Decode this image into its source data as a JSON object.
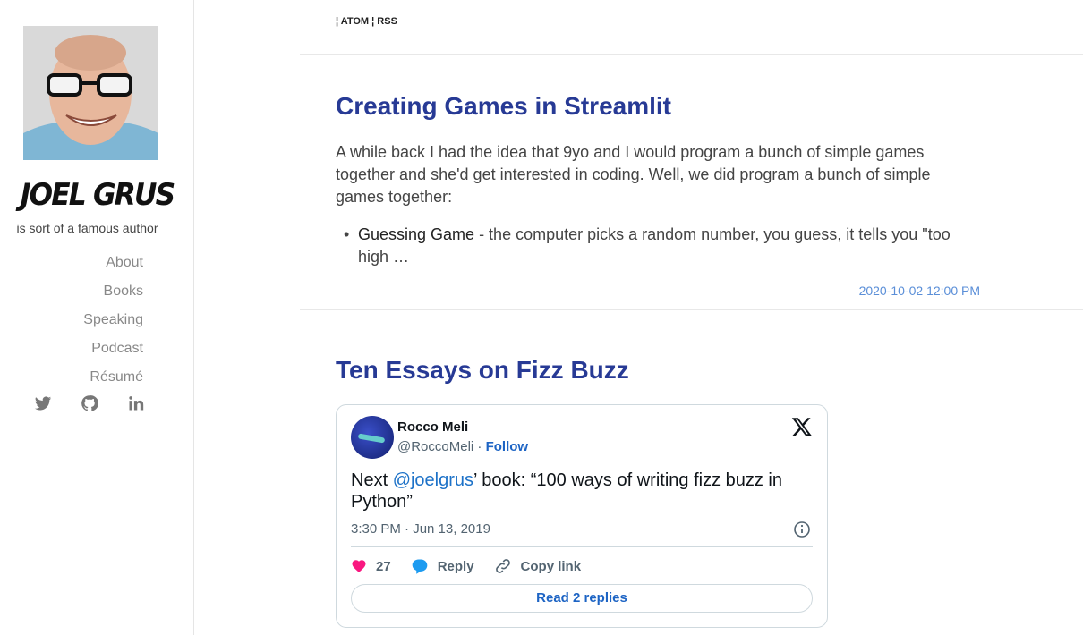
{
  "sidebar": {
    "title": "JOEL GRUS",
    "tagline": "is sort of a famous author",
    "nav": [
      "About",
      "Books",
      "Speaking",
      "Podcast",
      "Résumé"
    ],
    "social_icons": [
      "twitter-icon",
      "github-icon",
      "linkedin-icon"
    ]
  },
  "header": {
    "feeds": "¦ ATOM ¦ RSS"
  },
  "posts": [
    {
      "title": "Creating Games in Streamlit",
      "body": "A while back I had the idea that 9yo and I would program a bunch of simple games together and she'd get interested in coding. Well, we did program a bunch of simple games together:",
      "bullet_link": "Guessing Game",
      "bullet_text": " - the computer picks a random number, you guess, it tells you \"too high …",
      "date": "2020-10-02 12:00 PM"
    },
    {
      "title": "Ten Essays on Fizz Buzz"
    }
  ],
  "tweet": {
    "name": "Rocco Meli",
    "handle": "@RoccoMeli",
    "separator": " · ",
    "follow": "Follow",
    "text_before": "Next ",
    "mention": "@joelgrus",
    "text_after": "’ book: “100 ways of writing fizz buzz in Python”",
    "time": "3:30 PM · Jun 13, 2019",
    "likes": "27",
    "reply": "Reply",
    "copy_link": "Copy link",
    "read_replies": "Read 2 replies"
  },
  "colors": {
    "title_blue": "#273a95",
    "date_blue": "#5b8fd8",
    "like_pink": "#f91880",
    "reply_blue": "#1d9bf0"
  }
}
